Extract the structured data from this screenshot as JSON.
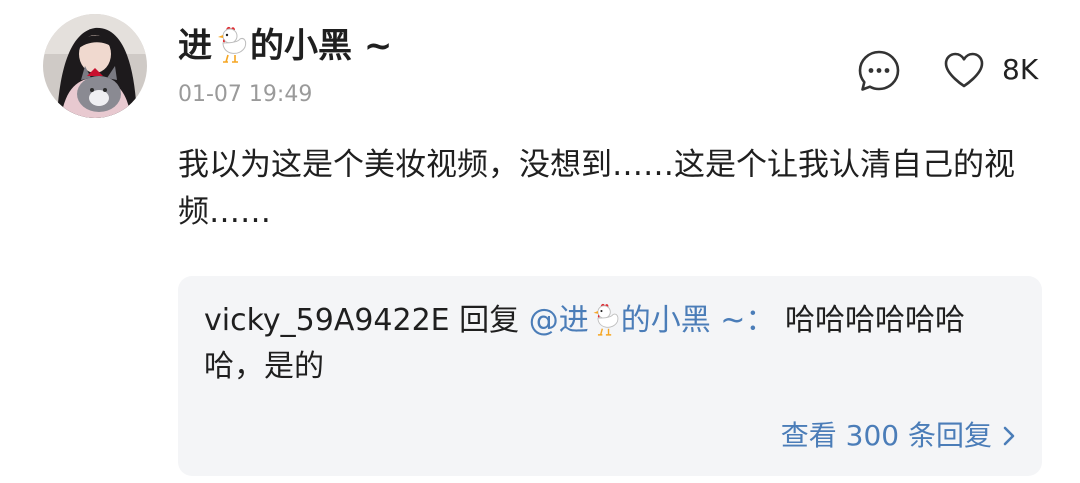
{
  "comment": {
    "user": {
      "name_prefix": "进",
      "name_emoji": "chicken-emoji",
      "name_suffix": "的小黑 ~"
    },
    "timestamp": "01-07 19:49",
    "text": "我以为这是个美妆视频，没想到……这是个让我认清自己的视频……",
    "actions": {
      "comment_icon": "comment-bubble-icon",
      "like_icon": "heart-outline-icon",
      "like_count": "8K"
    }
  },
  "reply": {
    "author": "vicky_59A9422E",
    "verb": " 回复 ",
    "mention_prefix": "@进",
    "mention_emoji": "chicken-emoji",
    "mention_suffix": "的小黑 ~：",
    "text": " 哈哈哈哈哈哈哈，是的",
    "view_more": "查看 300 条回复",
    "view_more_icon": "chevron-right-icon"
  },
  "colors": {
    "link": "#4b7db8",
    "timestamp": "#9a9a9a",
    "reply_background": "#f4f5f7",
    "text": "#1f1f1f"
  }
}
